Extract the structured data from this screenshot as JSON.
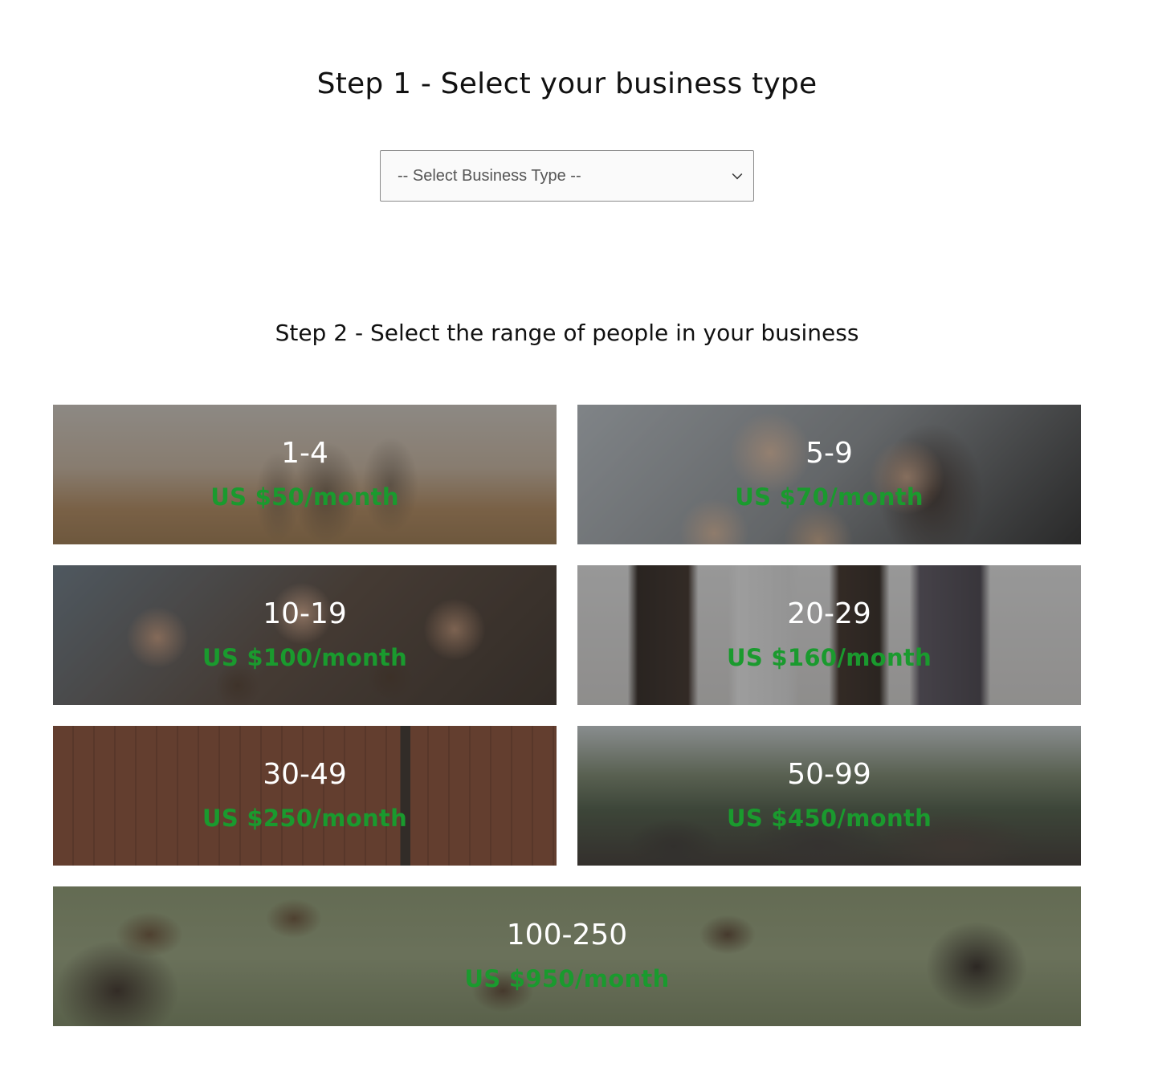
{
  "step1": {
    "title": "Step 1 - Select your business type",
    "select_value": "-- Select Business Type --"
  },
  "step2": {
    "title": "Step 2 - Select the range of people in your business"
  },
  "tiles": [
    {
      "range": "1-4",
      "price": "US $50/month"
    },
    {
      "range": "5-9",
      "price": "US $70/month"
    },
    {
      "range": "10-19",
      "price": "US $100/month"
    },
    {
      "range": "20-29",
      "price": "US $160/month"
    },
    {
      "range": "30-49",
      "price": "US $250/month"
    },
    {
      "range": "50-99",
      "price": "US $450/month"
    },
    {
      "range": "100-250",
      "price": "US $950/month"
    }
  ],
  "colors": {
    "price_green": "#1a9a2e",
    "range_text": "#ffffff"
  }
}
